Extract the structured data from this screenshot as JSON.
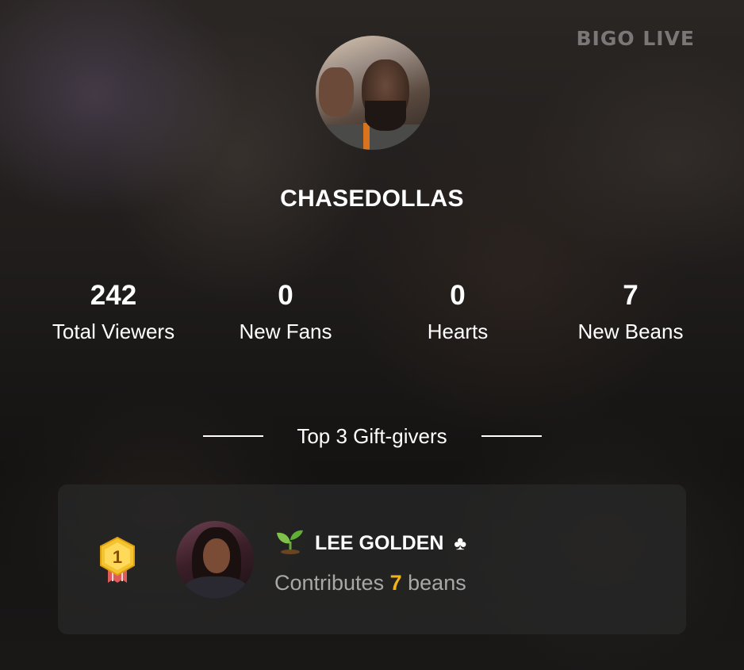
{
  "brand": {
    "logo_text": "BIGO LIVE"
  },
  "streamer": {
    "username": "CHASEDOLLAS"
  },
  "stats": [
    {
      "value": "242",
      "label": "Total Viewers"
    },
    {
      "value": "0",
      "label": "New Fans"
    },
    {
      "value": "0",
      "label": "Hearts"
    },
    {
      "value": "7",
      "label": "New Beans"
    }
  ],
  "gift_section": {
    "title": "Top 3 Gift-givers",
    "givers": [
      {
        "rank": "1",
        "name": "LEE GOLDEN",
        "name_prefix_icon": "sprout-icon",
        "name_suffix_icon": "clubs-icon",
        "name_suffix_glyph": "♣",
        "contrib_prefix": "Contributes",
        "contrib_amount": "7",
        "contrib_suffix": "beans"
      }
    ]
  },
  "colors": {
    "highlight": "#f0b417",
    "card_bg": "#282828",
    "muted_text": "#a8a8a8",
    "medal_gold": "#f4c430",
    "medal_ribbon": "#e05a5a"
  }
}
